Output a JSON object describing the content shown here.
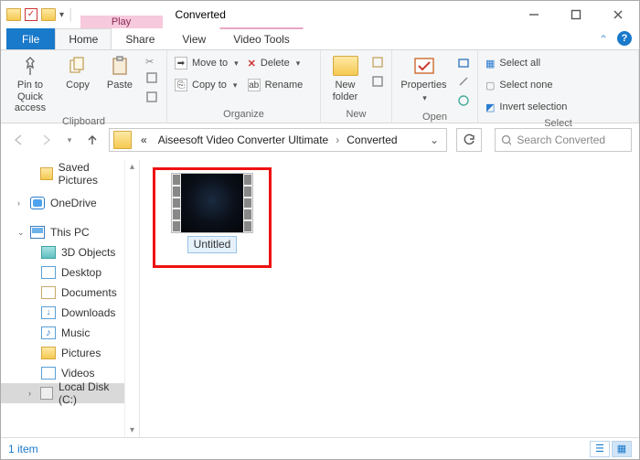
{
  "window": {
    "title": "Converted"
  },
  "contextual": {
    "category": "Play",
    "tab": "Video Tools"
  },
  "tabs": {
    "file": "File",
    "home": "Home",
    "share": "Share",
    "view": "View"
  },
  "ribbon": {
    "clipboard": {
      "label": "Clipboard",
      "pin": "Pin to Quick\naccess",
      "copy": "Copy",
      "paste": "Paste"
    },
    "organize": {
      "label": "Organize",
      "moveto": "Move to",
      "copyto": "Copy to",
      "delete": "Delete",
      "rename": "Rename"
    },
    "new": {
      "label": "New",
      "newfolder": "New\nfolder"
    },
    "open": {
      "label": "Open",
      "properties": "Properties"
    },
    "select": {
      "label": "Select",
      "all": "Select all",
      "none": "Select none",
      "invert": "Invert selection"
    }
  },
  "breadcrumb": {
    "prefix": "«",
    "items": [
      "Aiseesoft Video Converter Ultimate",
      "Converted"
    ]
  },
  "search": {
    "placeholder": "Search Converted"
  },
  "tree": {
    "saved_pictures": "Saved Pictures",
    "onedrive": "OneDrive",
    "this_pc": "This PC",
    "objects3d": "3D Objects",
    "desktop": "Desktop",
    "documents": "Documents",
    "downloads": "Downloads",
    "music": "Music",
    "pictures": "Pictures",
    "videos": "Videos",
    "localdisk": "Local Disk (C:)"
  },
  "content": {
    "items": [
      {
        "name": "Untitled"
      }
    ]
  },
  "status": {
    "text": "1 item"
  }
}
